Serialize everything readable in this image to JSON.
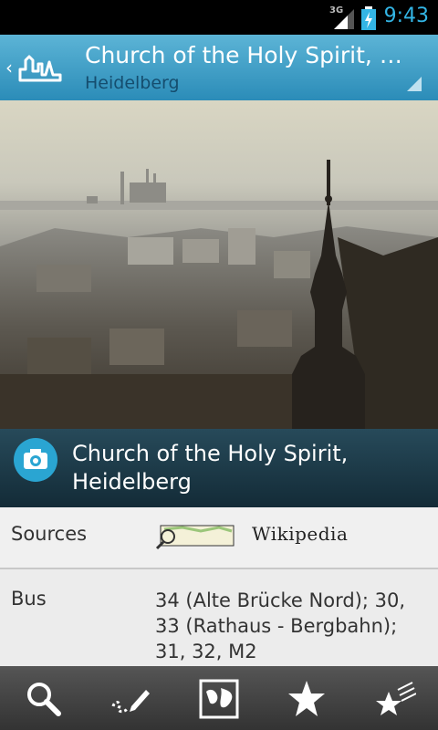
{
  "status_bar": {
    "network": "3G",
    "time": "9:43"
  },
  "action_bar": {
    "title": "Church of the Holy Spirit, H…",
    "subtitle": "Heidelberg",
    "back_icon": "chevron-left-icon",
    "logo_icon": "skyline-icon"
  },
  "photo": {
    "caption": "Church of the Holy Spirit, Heidelberg",
    "camera_icon": "camera-icon"
  },
  "sources": {
    "label": "Sources",
    "logos": [
      "OpenStreetMap",
      "Wikipedia"
    ],
    "wikipedia_text": "Wikipedia"
  },
  "bus": {
    "label": "Bus",
    "value": "34 (Alte Brücke Nord); 30, 33 (Rathaus - Bergbahn); 31, 32, M2"
  },
  "toolbar": {
    "icons": [
      "search-icon",
      "edit-icon",
      "map-icon",
      "star-icon",
      "stars-icon"
    ]
  },
  "colors": {
    "accent": "#33b5e5",
    "action_bar": "#3fa0cb",
    "caption_bg": "#1d3a48",
    "toolbar": "#3a3a3a"
  }
}
